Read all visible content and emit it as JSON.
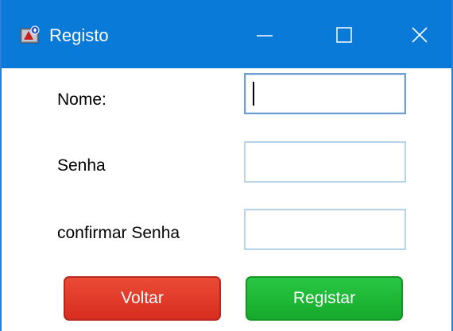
{
  "window": {
    "title": "Registo"
  },
  "titlebar": {
    "icons": {
      "app": "app-icon",
      "minimize": "minimize-icon",
      "maximize": "maximize-icon",
      "close": "close-icon"
    },
    "color": "#0a7ad9"
  },
  "form": {
    "nome_label": "Nome:",
    "senha_label": "Senha",
    "confirmar_label": "confirmar Senha",
    "nome_value": "",
    "senha_value": "",
    "confirmar_value": ""
  },
  "buttons": {
    "voltar_label": "Voltar",
    "registar_label": "Registar",
    "voltar_color": "#d82d1f",
    "registar_color": "#16a92b"
  }
}
